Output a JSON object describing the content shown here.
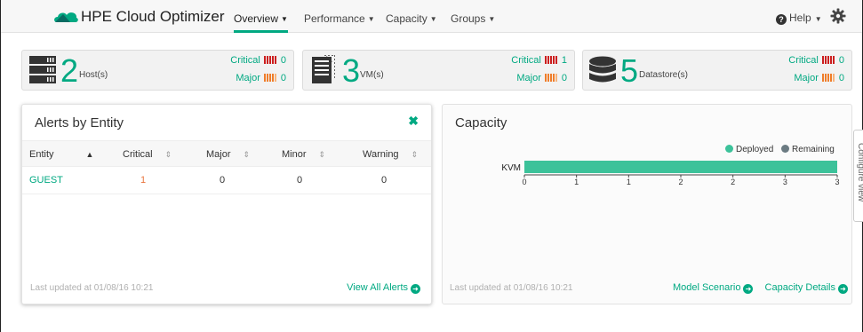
{
  "header": {
    "brand": "HPE Cloud Optimizer",
    "nav": [
      {
        "label": "Overview",
        "active": true
      },
      {
        "label": "Performance",
        "active": false
      },
      {
        "label": "Capacity",
        "active": false
      },
      {
        "label": "Groups",
        "active": false
      }
    ],
    "help_label": "Help",
    "settings_icon": "gear-icon"
  },
  "summary": [
    {
      "icon": "server-icon",
      "count": "2",
      "unit": "Host(s)",
      "critical_label": "Critical",
      "critical": "0",
      "major_label": "Major",
      "major": "0"
    },
    {
      "icon": "vm-icon",
      "count": "3",
      "unit": "VM(s)",
      "critical_label": "Critical",
      "critical": "1",
      "major_label": "Major",
      "major": "0"
    },
    {
      "icon": "datastore-icon",
      "count": "5",
      "unit": "Datastore(s)",
      "critical_label": "Critical",
      "critical": "0",
      "major_label": "Major",
      "major": "0"
    }
  ],
  "alerts": {
    "title": "Alerts by Entity",
    "columns": [
      "Entity",
      "Critical",
      "Major",
      "Minor",
      "Warning"
    ],
    "rows": [
      {
        "entity": "GUEST",
        "critical": "1",
        "major": "0",
        "minor": "0",
        "warning": "0"
      }
    ],
    "last_updated": "Last updated at 01/08/16 10:21",
    "view_all": "View All Alerts"
  },
  "capacity": {
    "title": "Capacity",
    "last_updated": "Last updated at 01/08/16 10:21",
    "model_scenario": "Model Scenario",
    "capacity_details": "Capacity Details",
    "side_tab": "Configure view"
  },
  "chart_data": {
    "type": "bar",
    "orientation": "horizontal",
    "categories": [
      "KVM"
    ],
    "series": [
      {
        "name": "Deployed",
        "color": "#3cc29a",
        "values": [
          3
        ]
      },
      {
        "name": "Remaining",
        "color": "#6b7b82",
        "values": [
          0
        ]
      }
    ],
    "x_tick_labels": [
      "0",
      "1",
      "1",
      "2",
      "2",
      "3",
      "3"
    ],
    "xlim": [
      0,
      3
    ],
    "legend": "top-right",
    "grid": false
  },
  "colors": {
    "accent": "#01a982",
    "critical": "#cc1f1f",
    "major": "#ef7d2a"
  }
}
